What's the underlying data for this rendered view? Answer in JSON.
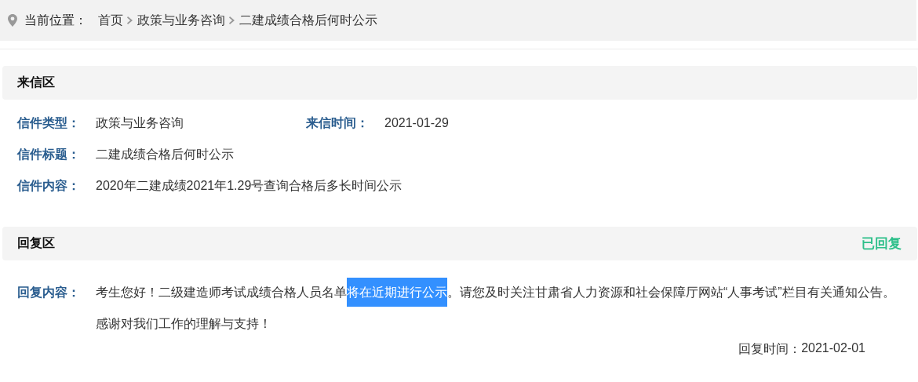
{
  "breadcrumb": {
    "label": "当前位置：",
    "items": [
      {
        "text": "首页"
      },
      {
        "text": "政策与业务咨询"
      },
      {
        "text": "二建成绩合格后何时公示"
      }
    ]
  },
  "letter_section": {
    "title": "来信区",
    "fields": [
      {
        "label": "信件类型：",
        "value": "政策与业务咨询"
      },
      {
        "label": "来信时间：",
        "value": "2021-01-29"
      },
      {
        "label": "信件标题：",
        "value": "二建成绩合格后何时公示"
      },
      {
        "label": "信件内容：",
        "value": "2020年二建成绩2021年1.29号查询合格后多长时间公示"
      }
    ]
  },
  "reply_section": {
    "title": "回复区",
    "status": "已回复",
    "label": "回复内容：",
    "segments": [
      {
        "text": "考生您好！二级建造师考试成绩合格人员名单",
        "selected": false
      },
      {
        "text": "将在近期进行公示",
        "selected": true
      },
      {
        "text": "。请您及时关注甘肃省人力资源和社会保障厅网站“人事考试”栏目有关通知公告。感谢对我们工作的理解与支持！",
        "selected": false
      }
    ],
    "reply_time_label": "回复时间：",
    "reply_time": "2021-02-01"
  }
}
